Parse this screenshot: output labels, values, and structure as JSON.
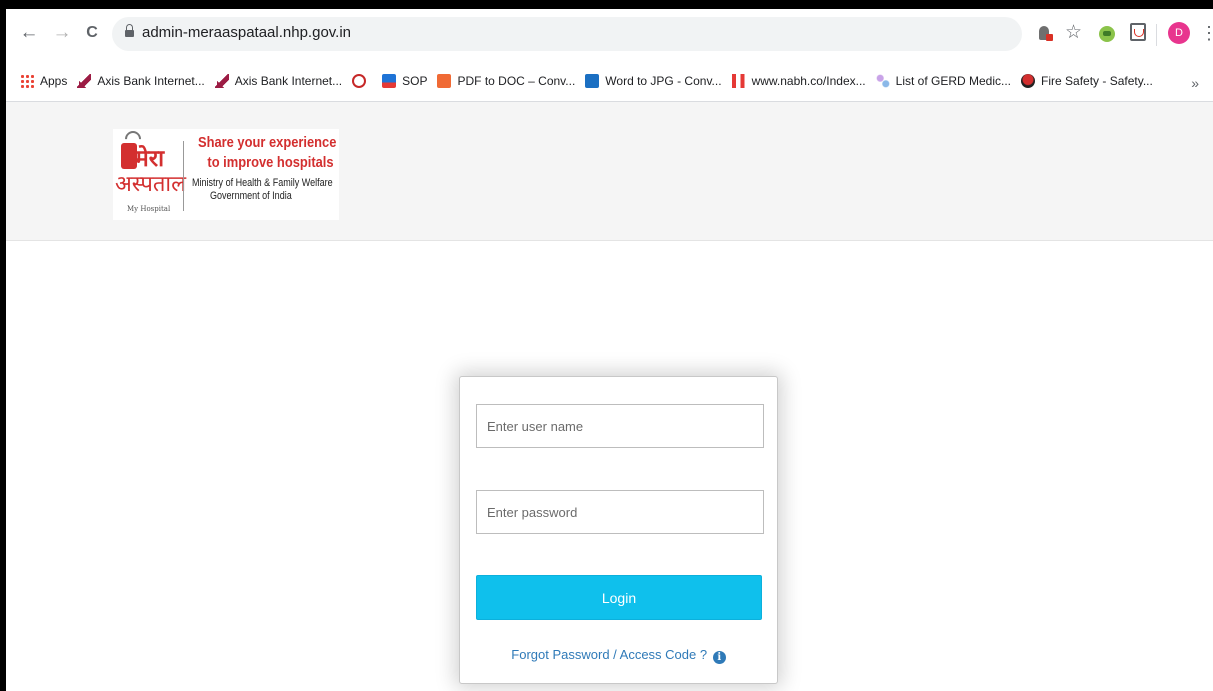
{
  "browser": {
    "url": "admin-meraaspataal.nhp.gov.in",
    "avatar_letter": "D",
    "nav": {
      "back": "←",
      "forward": "→",
      "reload": "C"
    },
    "star": "☆",
    "menu": "⋮",
    "more_bookmarks": "»",
    "bookmarks": [
      {
        "label": "Apps",
        "icon": "apps-icon"
      },
      {
        "label": "Axis Bank Internet...",
        "icon": "axis-bank-icon"
      },
      {
        "label": "Axis Bank Internet...",
        "icon": "axis-bank-icon"
      },
      {
        "label": "",
        "icon": "red-circle-icon"
      },
      {
        "label": "SOP",
        "icon": "sop-icon"
      },
      {
        "label": "PDF to DOC – Conv...",
        "icon": "pdf-icon"
      },
      {
        "label": "Word to JPG - Conv...",
        "icon": "word-icon"
      },
      {
        "label": "www.nabh.co/Index...",
        "icon": "nabh-icon"
      },
      {
        "label": "List of GERD Medic...",
        "icon": "gerd-icon"
      },
      {
        "label": "Fire Safety - Safety...",
        "icon": "fire-icon"
      }
    ]
  },
  "logo": {
    "hindi_line1": "मेरा",
    "hindi_line2": "अस्पताल",
    "sub": "My Hospital",
    "tagline1": "Share your experience",
    "tagline2": "to improve hospitals",
    "ministry": "Ministry of Health & Family Welfare",
    "government": "Government of India"
  },
  "login": {
    "username_placeholder": "Enter user name",
    "password_placeholder": "Enter password",
    "button": "Login",
    "forgot": "Forgot Password / Access Code ?",
    "info_glyph": "i"
  },
  "colors": {
    "login_button": "#0fc0ec",
    "link": "#2f7ab8",
    "brand_red": "#d32f2f"
  }
}
